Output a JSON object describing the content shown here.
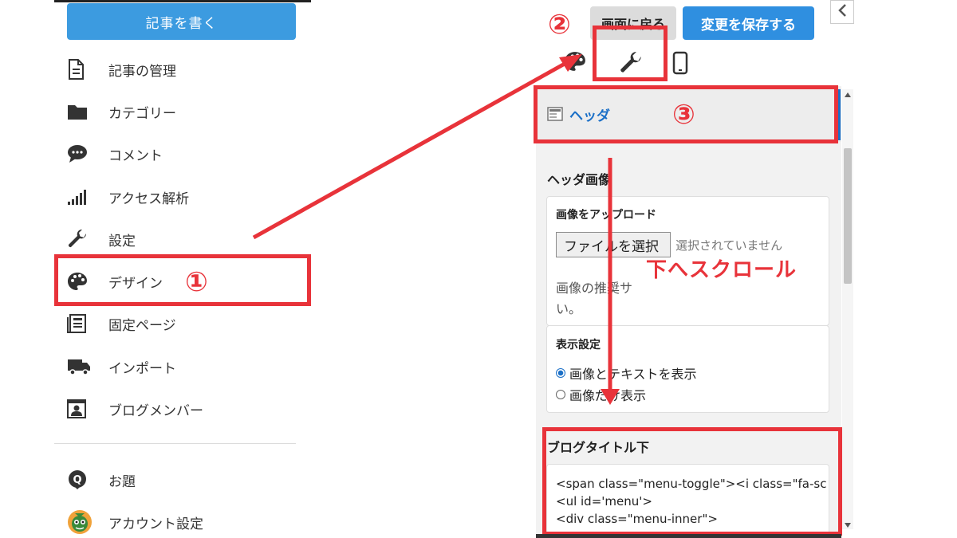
{
  "sidebar": {
    "write_button": "記事を書く",
    "items": [
      {
        "label": "記事の管理",
        "icon": "document-icon"
      },
      {
        "label": "カテゴリー",
        "icon": "folder-icon"
      },
      {
        "label": "コメント",
        "icon": "comment-icon"
      },
      {
        "label": "アクセス解析",
        "icon": "signal-bars-icon"
      },
      {
        "label": "設定",
        "icon": "wrench-icon"
      },
      {
        "label": "デザイン",
        "icon": "palette-icon"
      },
      {
        "label": "固定ページ",
        "icon": "pages-icon"
      },
      {
        "label": "インポート",
        "icon": "truck-icon"
      },
      {
        "label": "ブログメンバー",
        "icon": "member-card-icon"
      }
    ],
    "extra_items": [
      {
        "label": "お題",
        "icon": "odai-icon"
      },
      {
        "label": "アカウント設定",
        "icon": "avatar-icon"
      }
    ]
  },
  "annotations": {
    "step1": "①",
    "step2": "②",
    "step3": "③",
    "scroll_hint": "下へスクロール",
    "accent": "#e8333a"
  },
  "panel": {
    "back_button": "画面に戻る",
    "save_button": "変更を保存する",
    "tabs": [
      "palette-icon",
      "wrench-icon",
      "mobile-icon"
    ],
    "header_section": "ヘッダ",
    "header_image": {
      "title": "ヘッダ画像",
      "upload_label": "画像をアップロード",
      "file_button": "ファイルを選択",
      "file_status": "選択されていません",
      "recommend_line1": "画像の推奨サ",
      "recommend_line2": "い。"
    },
    "display_settings": {
      "title": "表示設定",
      "options": [
        "画像とテキストを表示",
        "画像だけ表示"
      ],
      "selected": 0
    },
    "below_title": {
      "title": "ブログタイトル下",
      "code_lines": [
        "<span class=\"menu-toggle\"><i class=\"fa-sc",
        "<ul id='menu'>",
        "<div class=\"menu-inner\">"
      ]
    }
  },
  "colors": {
    "primary_blue": "#3c9be0",
    "save_blue": "#2f8fe0",
    "link_blue": "#1a6fc7"
  }
}
